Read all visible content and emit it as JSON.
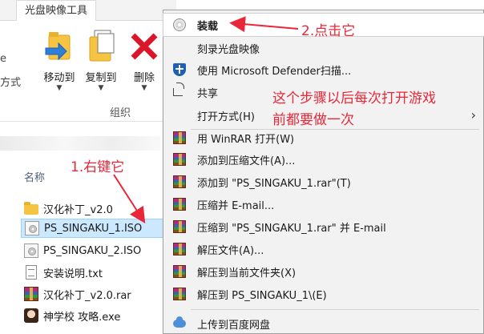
{
  "ribbon": {
    "tab_label": "光盘映像工具",
    "cut_text_1": "e",
    "cut_text_2": "方式",
    "move_to": "移动到",
    "copy_to": "复制到",
    "delete": "删除",
    "group_label": "组织"
  },
  "file_list": {
    "column_header": "名称",
    "files": [
      {
        "name": "汉化补丁_v2.0",
        "icon": "folder-icon"
      },
      {
        "name": "PS_SINGAKU_1.ISO",
        "icon": "disc-image-icon"
      },
      {
        "name": "PS_SINGAKU_2.ISO",
        "icon": "disc-image-icon"
      },
      {
        "name": "安装说明.txt",
        "icon": "text-file-icon"
      },
      {
        "name": "汉化补丁_v2.0.rar",
        "icon": "winrar-archive-icon"
      },
      {
        "name": "神学校 攻略.exe",
        "icon": "exe-icon"
      }
    ]
  },
  "context_menu": {
    "items": [
      {
        "label": "装载",
        "icon": "disc-icon"
      },
      {
        "label": "刻录光盘映像",
        "icon": ""
      },
      {
        "label": "使用 Microsoft Defender扫描...",
        "icon": "defender-shield-icon"
      },
      {
        "label": "共享",
        "icon": "share-icon"
      },
      {
        "label": "打开方式(H)",
        "icon": ""
      },
      {
        "label": "用 WinRAR 打开(W)",
        "icon": "winrar-icon"
      },
      {
        "label": "添加到压缩文件(A)...",
        "icon": "winrar-icon"
      },
      {
        "label": "添加到 \"PS_SINGAKU_1.rar\"(T)",
        "icon": "winrar-icon"
      },
      {
        "label": "压缩并 E-mail...",
        "icon": "winrar-icon"
      },
      {
        "label": "压缩到 \"PS_SINGAKU_1.rar\" 并 E-mail",
        "icon": "winrar-icon"
      },
      {
        "label": "解压文件(A)...",
        "icon": "winrar-icon"
      },
      {
        "label": "解压到当前文件夹(X)",
        "icon": "winrar-icon"
      },
      {
        "label": "解压到 PS_SINGAKU_1\\(E)",
        "icon": "winrar-icon"
      },
      {
        "label": "上传到百度网盘",
        "icon": "baidu-cloud-icon"
      }
    ]
  },
  "annotations": {
    "step1": "1.右键它",
    "step2": "2.点击它",
    "note_line1": "这个步骤以后每次打开游戏",
    "note_line2": "前都要做一次",
    "color": "#e8283a"
  },
  "colors": {
    "selection_bg": "#cce8ff",
    "menu_bg": "#f2f2f2",
    "annotation": "#e8283a"
  }
}
